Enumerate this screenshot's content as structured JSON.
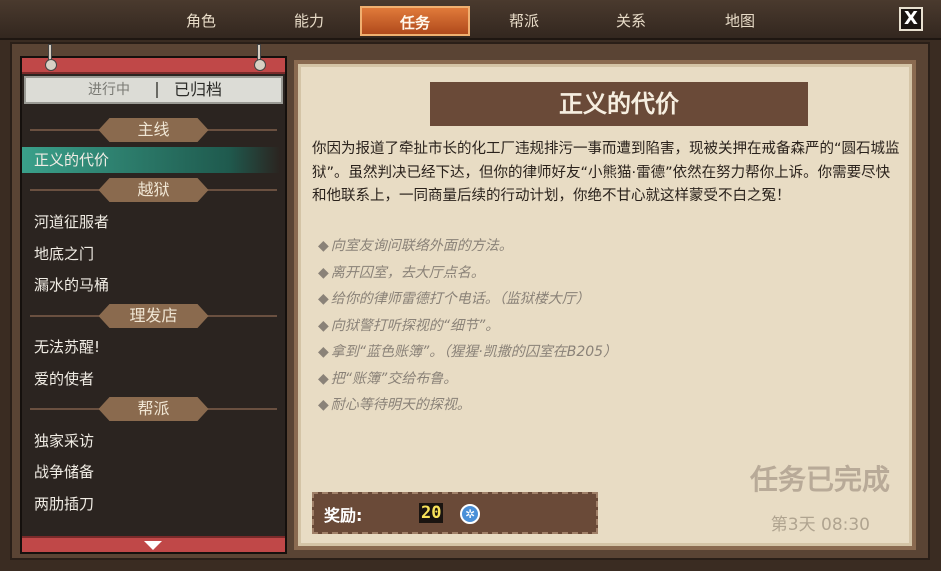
{
  "tabs": [
    {
      "label": "角色",
      "active": false
    },
    {
      "label": "能力",
      "active": false
    },
    {
      "label": "任务",
      "active": true
    },
    {
      "label": "帮派",
      "active": false
    },
    {
      "label": "关系",
      "active": false
    },
    {
      "label": "地图",
      "active": false
    }
  ],
  "close_label": "X",
  "subtabs": {
    "in_progress": "进行中",
    "archived": "已归档"
  },
  "categories": [
    {
      "header": "主线",
      "items": [
        "正义的代价"
      ]
    },
    {
      "header": "越狱",
      "items": [
        "河道征服者",
        "地底之门",
        "漏水的马桶"
      ]
    },
    {
      "header": "理发店",
      "items": [
        "无法苏醒!",
        "爱的使者"
      ]
    },
    {
      "header": "帮派",
      "items": [
        "独家采访",
        "战争储备",
        "两肋插刀"
      ]
    }
  ],
  "selected_quest": "正义的代价",
  "quest": {
    "title": "正义的代价",
    "description": "你因为报道了牵扯市长的化工厂违规排污一事而遭到陷害，现被关押在戒备森严的“圆石城监狱”。虽然判决已经下达，但你的律师好友“小熊猫·雷德”依然在努力帮你上诉。你需要尽快和他联系上，一同商量后续的行动计划，你绝不甘心就这样蒙受不白之冤！",
    "objectives": [
      "向室友询问联络外面的方法。",
      "离开囚室，去大厅点名。",
      "给你的律师雷德打个电话。（监狱楼大厅）",
      "向狱警打听探视的“细节”。",
      "拿到“蓝色账簿”。（猩猩·凯撒的囚室在B205）",
      "把“账簿”交给布鲁。",
      "耐心等待明天的探视。"
    ],
    "objective_bullet": "◆",
    "reward_label": "奖励:",
    "reward_value": "20",
    "reward_icon": "gear-coin-icon",
    "status": "任务已完成",
    "time": "第3天  08:30"
  },
  "colors": {
    "accent_tab": "#d0622a",
    "selected_item": "#3aa08a",
    "banner": "#6a4a38",
    "parchment": "#e8dcc4"
  }
}
